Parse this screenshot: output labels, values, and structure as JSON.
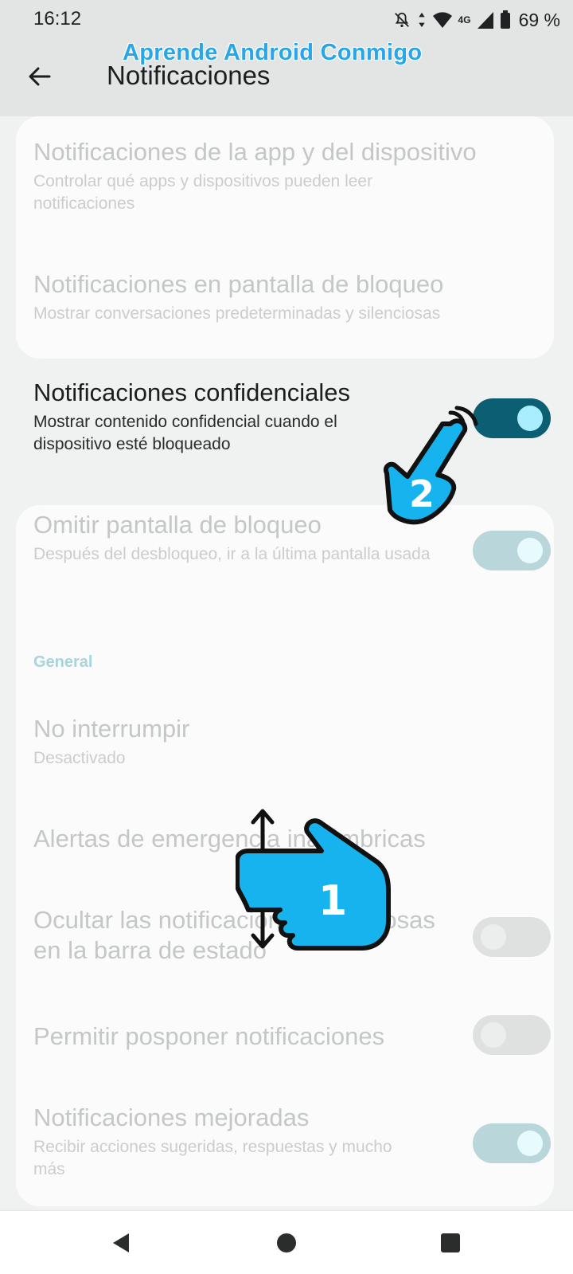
{
  "status_bar": {
    "time": "16:12",
    "network": "4G",
    "battery": "69 %",
    "icons": [
      "bell-off-icon",
      "data-arrows-icon",
      "wifi-icon",
      "signal-icon",
      "battery-icon"
    ]
  },
  "watermark": "Aprende Android Conmigo",
  "header": {
    "title": "Notificaciones",
    "back_icon": "arrow-left-icon"
  },
  "settings": [
    {
      "title": "Notificaciones de la app y del dispositivo",
      "subtitle": "Controlar qué apps y dispositivos pueden leer notificaciones"
    },
    {
      "title": "Notificaciones en pantalla de bloqueo",
      "subtitle": "Mostrar conversaciones predeterminadas y silenciosas"
    },
    {
      "title": "Notificaciones confidenciales",
      "subtitle": "Mostrar contenido confidencial cuando el dispositivo esté bloqueado",
      "toggle": "on"
    },
    {
      "title": "Omitir pantalla de bloqueo",
      "subtitle": "Después del desbloqueo, ir a la última pantalla usada",
      "toggle": "on"
    }
  ],
  "section_general": "General",
  "general": [
    {
      "title": "No interrumpir",
      "subtitle": "Desactivado"
    },
    {
      "title": "Alertas de emergencia inalámbricas"
    },
    {
      "title": "Ocultar las notificaciones silenciosas en la barra de estado",
      "toggle": "off"
    },
    {
      "title": "Permitir posponer notificaciones",
      "toggle": "off"
    },
    {
      "title": "Notificaciones mejoradas",
      "subtitle": "Recibir acciones sugeridas, respuestas y mucho más",
      "toggle": "on"
    }
  ],
  "annotations": {
    "step1": "1",
    "step2": "2",
    "colors": {
      "hand": "#16b3ee",
      "outline": "#111111"
    }
  },
  "nav_bar": [
    "back-triangle-icon",
    "home-circle-icon",
    "recents-square-icon"
  ]
}
